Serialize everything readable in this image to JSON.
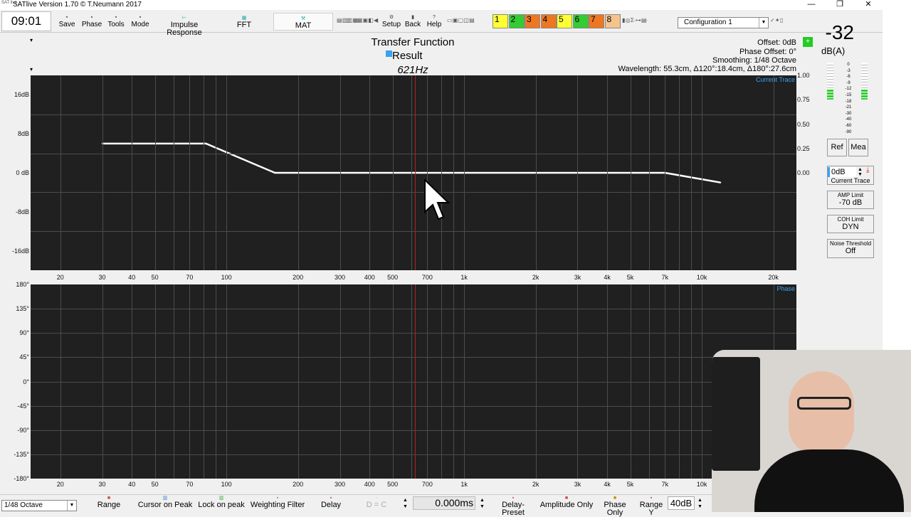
{
  "app": {
    "title": "SATlive Version 1.70 © T.Neumann 2017",
    "logo": "SAT live"
  },
  "window_controls": {
    "minimize": "—",
    "maximize": "❐",
    "close": "✕"
  },
  "toolbar": {
    "clock": "09:01",
    "buttons": [
      {
        "label": "Save",
        "icon": "save-icon"
      },
      {
        "label": "Phase",
        "icon": "phase-icon"
      },
      {
        "label": "Tools",
        "icon": "tools-icon"
      },
      {
        "label": "Mode",
        "icon": "mode-icon"
      }
    ],
    "tabs": [
      {
        "label": "Impulse Response",
        "icon": "impulse-icon"
      },
      {
        "label": "FFT",
        "icon": "fft-icon"
      },
      {
        "label": "MAT",
        "icon": "mat-icon"
      }
    ],
    "nav": [
      {
        "label": "Setup",
        "icon": "setup-icon"
      },
      {
        "label": "Back",
        "icon": "back-icon"
      },
      {
        "label": "Help",
        "icon": "help-icon"
      }
    ],
    "channels": [
      {
        "label": "1",
        "color": "#ffff33"
      },
      {
        "label": "2",
        "color": "#33cc33"
      },
      {
        "label": "3",
        "color": "#ee7722"
      },
      {
        "label": "4",
        "color": "#ee7722"
      },
      {
        "label": "5",
        "color": "#ffff33"
      },
      {
        "label": "6",
        "color": "#33cc33"
      },
      {
        "label": "7",
        "color": "#ee7722"
      },
      {
        "label": "8",
        "color": "#f4c48c"
      }
    ],
    "configuration": "Configuration 1"
  },
  "main": {
    "title": "Transfer Function",
    "legend": "Result",
    "frequency": "621Hz",
    "offset": "Offset: 0dB",
    "phase_offset": "Phase Offset: 0°",
    "smoothing": "Smoothing: 1/48 Octave",
    "wavelength": "Wavelength: 55.3cm, Δ120°:18.4cm, Δ180°:27.6cm"
  },
  "level": {
    "value": "-32",
    "unit": "dB(A)",
    "scale": [
      "0",
      "-3",
      "-6",
      "-9",
      "-12",
      "-15",
      "-18",
      "-21",
      "-30",
      "-40",
      "-60",
      "-90"
    ]
  },
  "right_panel": {
    "ref": "Ref",
    "mea": "Mea",
    "offset_value": "0dB",
    "current_trace": "Current Trace",
    "amp_limit_label": "AMP Limit",
    "amp_limit_value": "-70 dB",
    "coh_limit_label": "COH Limit",
    "coh_limit_value": "DYN",
    "noise_label": "Noise Threshold",
    "noise_value": "Off"
  },
  "amp_plot": {
    "trace_label": "Current Trace",
    "y_labels": [
      "16dB",
      "8dB",
      "0 dB",
      "-8dB",
      "-16dB"
    ],
    "coh_labels": [
      "1.00",
      "0.75",
      "0.50",
      "0.25",
      "0.00"
    ]
  },
  "phase_plot": {
    "trace_label": "Phase",
    "y_labels": [
      "180°",
      "135°",
      "90°",
      "45°",
      "0°",
      "-45°",
      "-90°",
      "-135°",
      "-180°"
    ]
  },
  "x_ticks": [
    {
      "label": "20",
      "f": 20
    },
    {
      "label": "30",
      "f": 30
    },
    {
      "label": "40",
      "f": 40
    },
    {
      "label": "50",
      "f": 50
    },
    {
      "label": "70",
      "f": 70
    },
    {
      "label": "100",
      "f": 100
    },
    {
      "label": "200",
      "f": 200
    },
    {
      "label": "300",
      "f": 300
    },
    {
      "label": "400",
      "f": 400
    },
    {
      "label": "500",
      "f": 500
    },
    {
      "label": "700",
      "f": 700
    },
    {
      "label": "1k",
      "f": 1000
    },
    {
      "label": "2k",
      "f": 2000
    },
    {
      "label": "3k",
      "f": 3000
    },
    {
      "label": "4k",
      "f": 4000
    },
    {
      "label": "5k",
      "f": 5000
    },
    {
      "label": "7k",
      "f": 7000
    },
    {
      "label": "10k",
      "f": 10000
    },
    {
      "label": "20k",
      "f": 20000
    }
  ],
  "chart_data": {
    "type": "line",
    "x_scale": "log",
    "xlim": [
      15,
      25000
    ],
    "ylim": [
      -20,
      20
    ],
    "cursor_hz": 621,
    "series": [
      {
        "name": "Result",
        "color": "#ffffff",
        "points": [
          [
            30,
            6
          ],
          [
            82,
            6
          ],
          [
            160,
            0
          ],
          [
            7000,
            0
          ],
          [
            12000,
            -2
          ]
        ]
      }
    ]
  },
  "statusbar": {
    "smoothing_select": "1/48 Octave",
    "buttons": [
      "Range",
      "Cursor on Peak",
      "Lock on peak",
      "Weighting Filter",
      "Delay"
    ],
    "dc": "D = C",
    "delay_value": "0.000ms",
    "buttons2": [
      "Delay-Preset",
      "Amplitude Only",
      "Phase Only",
      "Range Y"
    ],
    "range_y_value": "40dB"
  }
}
